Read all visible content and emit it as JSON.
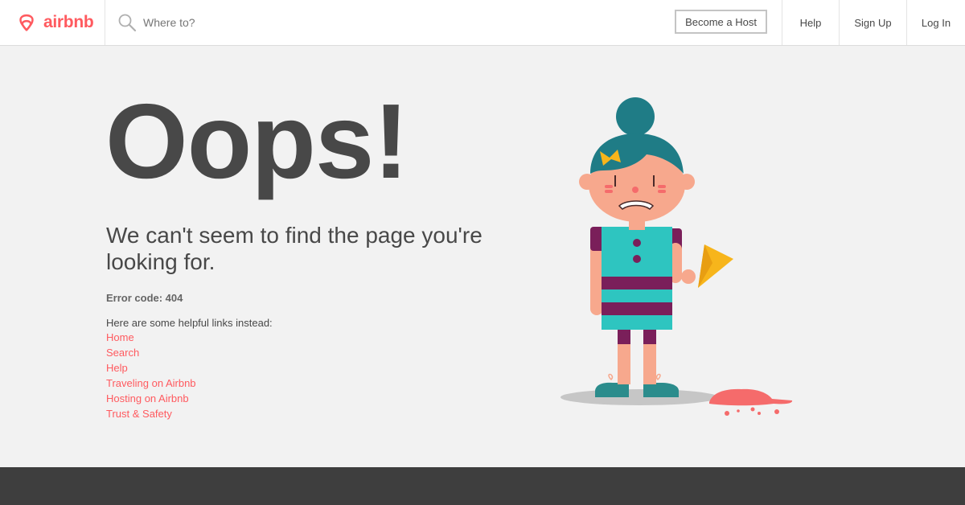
{
  "header": {
    "logo_text": "airbnb",
    "search_placeholder": "Where to?",
    "become_host": "Become a Host",
    "help": "Help",
    "sign_up": "Sign Up",
    "log_in": "Log In"
  },
  "main": {
    "heading": "Oops!",
    "subtitle": "We can't seem to find the page you're looking for.",
    "error_code": "Error code: 404",
    "links_intro": "Here are some helpful links instead:",
    "links": [
      "Home",
      "Search",
      "Help",
      "Traveling on Airbnb",
      "Hosting on Airbnb",
      "Trust & Safety"
    ]
  },
  "colors": {
    "brand": "#ff5a5f",
    "text": "#484848",
    "background": "#f2f2f2",
    "footer": "#3e3e3e"
  },
  "icons": {
    "logo": "airbnb-belo-icon",
    "search": "magnifier-icon"
  }
}
